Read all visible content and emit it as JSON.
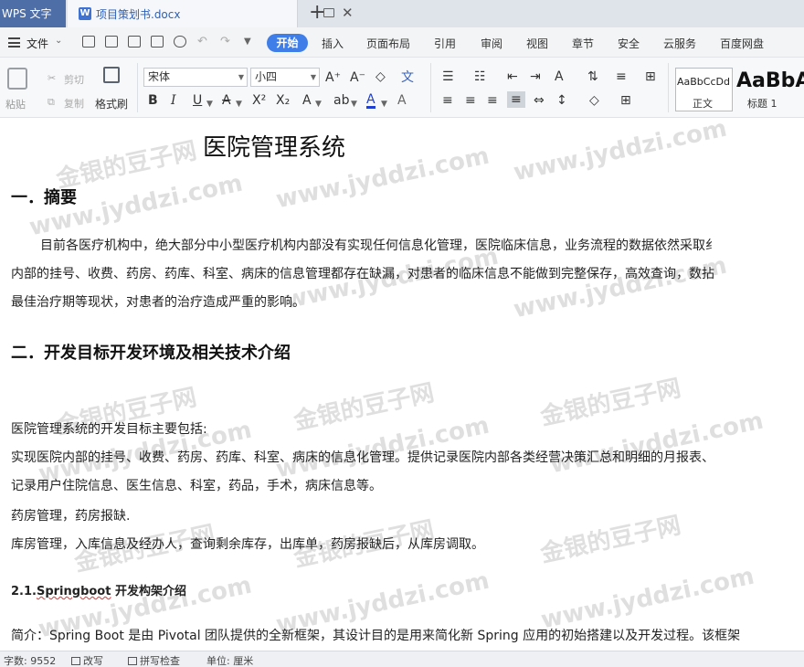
{
  "app": {
    "name": "WPS 文字"
  },
  "tab": {
    "doc_icon": "W",
    "doc_name": "项目策划书.docx",
    "close": "✕",
    "new": "+"
  },
  "menu": {
    "file": "文件",
    "caret": "⌄",
    "undo": "↶",
    "redo": "↷",
    "qa_more": "▼",
    "tabs": [
      "开始",
      "插入",
      "页面布局",
      "引用",
      "审阅",
      "视图",
      "章节",
      "安全",
      "云服务",
      "百度网盘"
    ]
  },
  "toolbar": {
    "paste": "粘贴",
    "cut": "剪切",
    "copy": "复制",
    "format_painter": "格式刷",
    "font_name": "宋体",
    "font_size": "小四",
    "grow_font": "A⁺",
    "shrink_font": "A⁻",
    "clear_format": "◇",
    "pinyin": "文",
    "bold": "B",
    "italic": "I",
    "underline": "U",
    "strike": "A",
    "superscript": "X²",
    "subscript": "X₂",
    "highlight": "A",
    "font_color": "A",
    "char_shade": "A",
    "styles": {
      "normal_sample": "AaBbCcDd",
      "normal_label": "正文",
      "heading1_sample": "AaBbA",
      "heading1_label": "标题 1"
    }
  },
  "document": {
    "title": "医院管理系统",
    "h1": "一．摘要",
    "abstract": [
      "目前各医疗机构中，绝大部分中小型医疗机构内部没有实现任何信息化管理，医院临床信息，业务流程的数据依然采取纟",
      "内部的挂号、收费、药房、药库、科室、病床的信息管理都存在缺漏，对患者的临床信息不能做到完整保存，高效查询，数拈",
      "最佳治疗期等现状，对患者的治疗造成严重的影响。"
    ],
    "h2": "二．开发目标开发环境及相关技术介绍",
    "goals": [
      "医院管理系统的开发目标主要包括:",
      "实现医院内部的挂号、收费、药房、药库、科室、病床的信息化管理。提供记录医院内部各类经营决策汇总和明细的月报表、",
      "记录用户住院信息、医生信息、科室，药品，手术，病床信息等。",
      "药房管理，药房报缺.",
      "库房管理，入库信息及经办人，查询剩余库存，出库单，药房报缺后，从库房调取。"
    ],
    "h3_num": "2.1.",
    "h3_word": "Springboot",
    "h3_rest": " 开发构架介绍",
    "intro": "简介：Spring Boot 是由 Pivotal 团队提供的全新框架，其设计目的是用来简化新 Spring 应用的初始搭建以及开发过程。该框架"
  },
  "watermarks": [
    "金银的豆子网",
    "www.jyddzi.com"
  ],
  "status": {
    "word_count": "字数: 9552",
    "track": "改写",
    "spell": "拼写检查",
    "unit": "单位: 厘米"
  }
}
